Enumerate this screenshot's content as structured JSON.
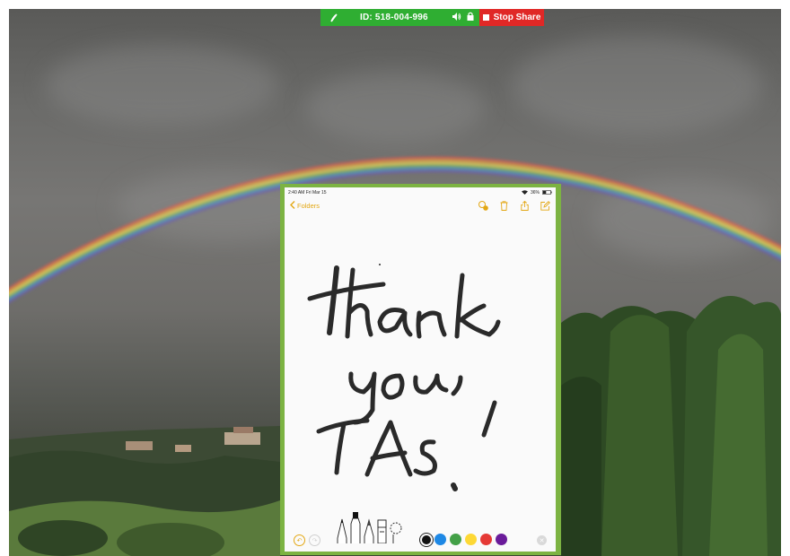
{
  "share_bar": {
    "meeting_id": "ID: 518-004-996",
    "stop_label": "Stop Share",
    "bar_color": "#2fae32",
    "stop_color": "#e02826",
    "icons": [
      "signal-icon",
      "speaker-icon",
      "lock-icon",
      "stop-icon"
    ]
  },
  "ipad": {
    "border_color": "#7cb342",
    "status_bar": {
      "time_date": "2:40 AM  Fri Mar 15",
      "battery": "36%"
    },
    "nav": {
      "back_label": "Folders",
      "accent_color": "#e3a713",
      "tools": [
        "add-people-icon",
        "trash-icon",
        "share-icon",
        "compose-icon"
      ]
    },
    "note": {
      "lines": [
        "thank",
        "you,",
        "TAs!"
      ]
    },
    "toolbar": {
      "tools": [
        "pen-icon",
        "marker-icon",
        "pencil-icon",
        "eraser-icon",
        "lasso-icon"
      ],
      "colors": [
        "#111111",
        "#1e88e5",
        "#43a047",
        "#fdd835",
        "#e53935",
        "#6a1b9a"
      ],
      "selected_color": "#111111"
    }
  }
}
